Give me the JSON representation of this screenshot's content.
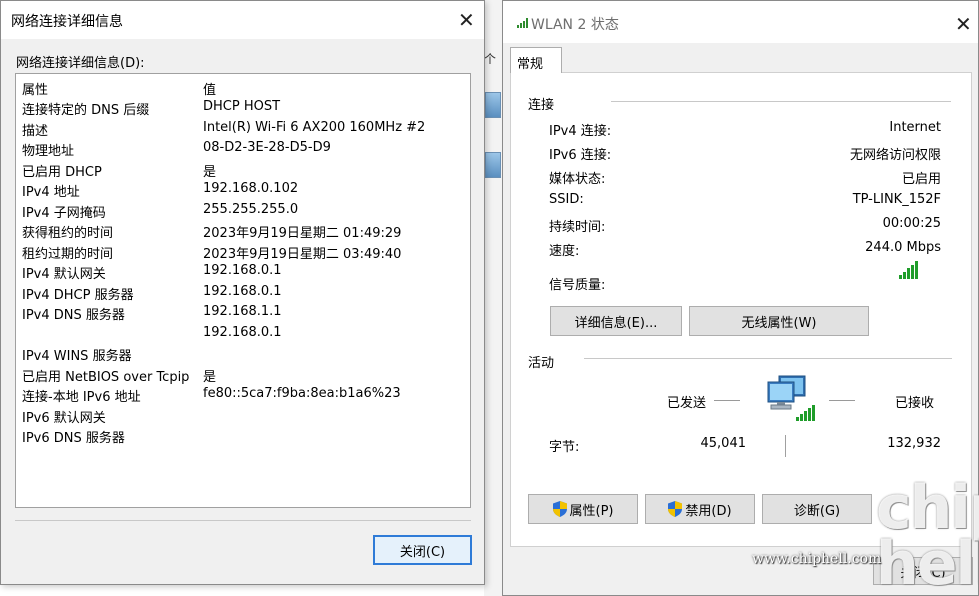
{
  "left_dialog": {
    "title": "网络连接详细信息",
    "section_label": "网络连接详细信息(D):",
    "columns": {
      "property": "属性",
      "value": "值"
    },
    "rows": [
      {
        "property": "连接特定的 DNS 后缀",
        "value": "DHCP HOST"
      },
      {
        "property": "描述",
        "value": "Intel(R) Wi-Fi 6 AX200 160MHz #2"
      },
      {
        "property": "物理地址",
        "value": "08-D2-3E-28-D5-D9"
      },
      {
        "property": "已启用 DHCP",
        "value": "是"
      },
      {
        "property": "IPv4 地址",
        "value": "192.168.0.102"
      },
      {
        "property": "IPv4 子网掩码",
        "value": "255.255.255.0"
      },
      {
        "property": "获得租约的时间",
        "value": "2023年9月19日星期二 01:49:29"
      },
      {
        "property": "租约过期的时间",
        "value": "2023年9月19日星期二 03:49:40"
      },
      {
        "property": "IPv4 默认网关",
        "value": "192.168.0.1"
      },
      {
        "property": "IPv4 DHCP 服务器",
        "value": "192.168.0.1"
      },
      {
        "property": "IPv4 DNS 服务器",
        "value": "192.168.1.1"
      },
      {
        "property": "",
        "value": "192.168.0.1"
      },
      {
        "property": "IPv4 WINS 服务器",
        "value": ""
      },
      {
        "property": "已启用 NetBIOS over Tcpip",
        "value": "是"
      },
      {
        "property": "连接-本地 IPv6 地址",
        "value": "fe80::5ca7:f9ba:8ea:b1a6%23"
      },
      {
        "property": "IPv6 默认网关",
        "value": ""
      },
      {
        "property": "IPv6 DNS 服务器",
        "value": ""
      }
    ],
    "close_button": "关闭(C)"
  },
  "background": {
    "partial_text": "个"
  },
  "right_dialog": {
    "title": "WLAN 2 状态",
    "tab": "常规",
    "connection_header": "连接",
    "connection_rows": [
      {
        "label": "IPv4 连接:",
        "value": "Internet"
      },
      {
        "label": "IPv6 连接:",
        "value": "无网络访问权限"
      },
      {
        "label": "媒体状态:",
        "value": "已启用"
      },
      {
        "label": "SSID:",
        "value": "TP-LINK_152F"
      },
      {
        "label": "持续时间:",
        "value": "00:00:25"
      },
      {
        "label": "速度:",
        "value": "244.0 Mbps"
      }
    ],
    "signal_label": "信号质量:",
    "signal_level": 5,
    "signal_max": 5,
    "details_button": "详细信息(E)...",
    "wireless_props_button": "无线属性(W)",
    "activity_header": "活动",
    "sent_label": "已发送",
    "received_label": "已接收",
    "bytes_label": "字节:",
    "bytes_sent": "45,041",
    "bytes_received": "132,932",
    "properties_button": "属性(P)",
    "disable_button": "禁用(D)",
    "diagnose_button": "诊断(G)",
    "close_button": "关闭(C)"
  },
  "watermark": {
    "logo": "chip hell",
    "url": "www.chiphell.com"
  },
  "colors": {
    "signal_green": "#1f9d2a",
    "focus_blue": "#2f7bd7",
    "shield_blue": "#2a6fd6",
    "shield_yellow": "#f2c200"
  }
}
